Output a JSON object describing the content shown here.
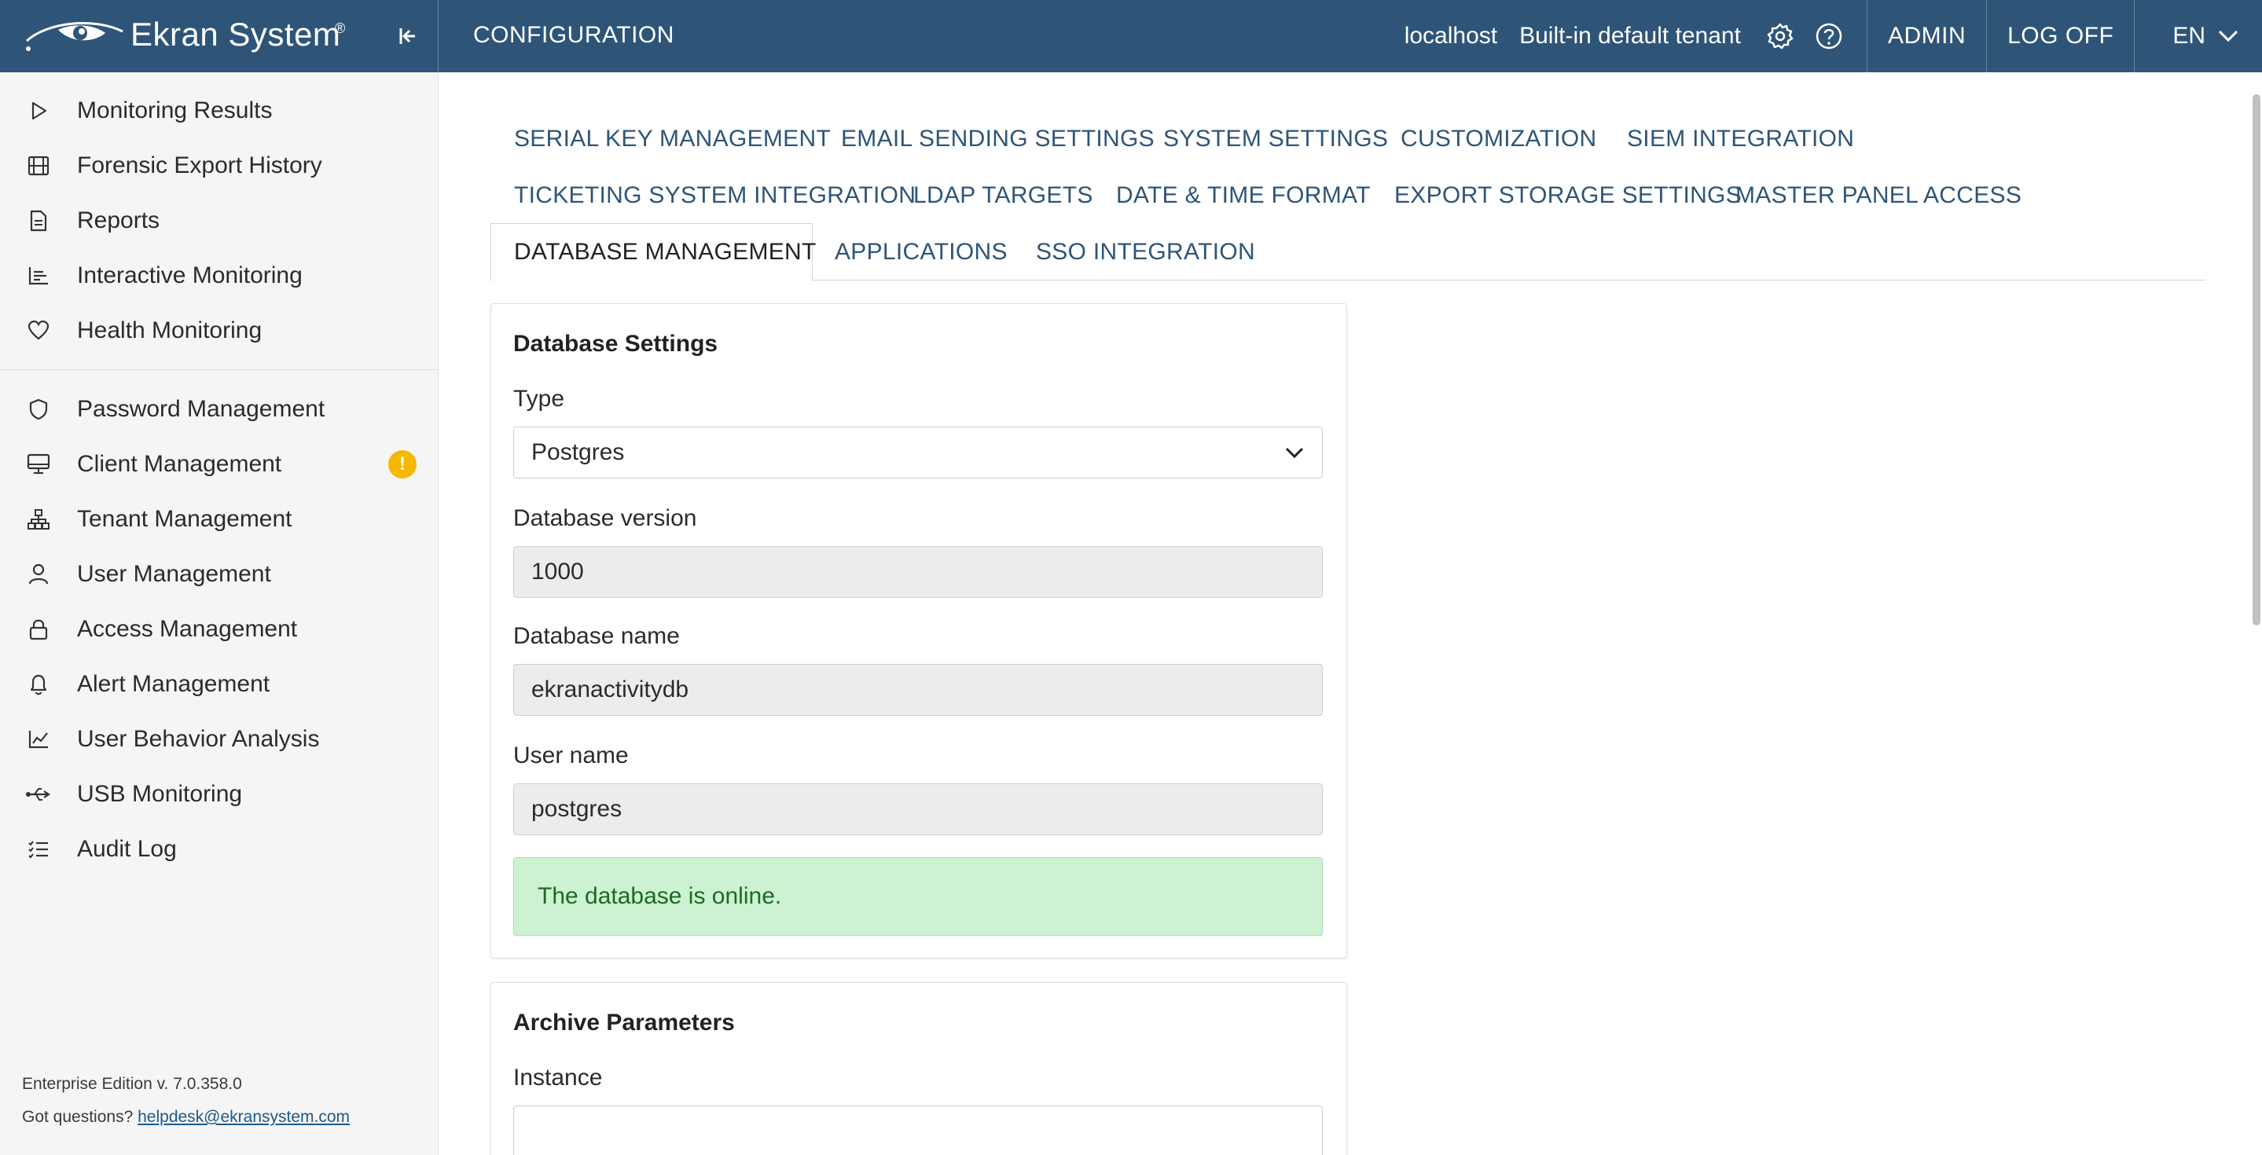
{
  "header": {
    "brand": "Ekran System",
    "brand_mark": "®",
    "page_title": "CONFIGURATION",
    "host": "localhost",
    "tenant": "Built-in default tenant",
    "admin": "ADMIN",
    "logoff": "LOG OFF",
    "language": "EN"
  },
  "sidebar": {
    "group1": [
      {
        "label": "Monitoring Results",
        "icon": "play-icon"
      },
      {
        "label": "Forensic Export History",
        "icon": "film-icon"
      },
      {
        "label": "Reports",
        "icon": "document-icon"
      },
      {
        "label": "Interactive Monitoring",
        "icon": "bar-chart-icon"
      },
      {
        "label": "Health Monitoring",
        "icon": "heart-icon"
      }
    ],
    "group2": [
      {
        "label": "Password Management",
        "icon": "shield-icon"
      },
      {
        "label": "Client Management",
        "icon": "monitor-icon"
      },
      {
        "label": "Tenant Management",
        "icon": "hierarchy-icon"
      },
      {
        "label": "User Management",
        "icon": "user-icon"
      },
      {
        "label": "Access Management",
        "icon": "lock-icon"
      },
      {
        "label": "Alert Management",
        "icon": "bell-icon"
      },
      {
        "label": "User Behavior Analysis",
        "icon": "trend-icon"
      },
      {
        "label": "USB Monitoring",
        "icon": "usb-icon"
      },
      {
        "label": "Audit Log",
        "icon": "checklist-icon"
      }
    ],
    "client_badge": "!",
    "edition": "Enterprise Edition v. 7.0.358.0",
    "questions": "Got questions?",
    "email": "helpdesk@ekransystem.com"
  },
  "tabs": {
    "row1": [
      "SERIAL KEY MANAGEMENT",
      "EMAIL SENDING SETTINGS",
      "SYSTEM SETTINGS",
      "CUSTOMIZATION",
      "SIEM INTEGRATION"
    ],
    "row2": [
      "TICKETING SYSTEM INTEGRATION",
      "LDAP TARGETS",
      "DATE & TIME FORMAT",
      "EXPORT STORAGE SETTINGS",
      "MASTER PANEL ACCESS"
    ],
    "row3": [
      "DATABASE MANAGEMENT",
      "APPLICATIONS",
      "SSO INTEGRATION"
    ],
    "active": "DATABASE MANAGEMENT"
  },
  "database_settings": {
    "title": "Database Settings",
    "type_label": "Type",
    "type_value": "Postgres",
    "version_label": "Database version",
    "version_value": "1000",
    "name_label": "Database name",
    "name_value": "ekranactivitydb",
    "user_label": "User name",
    "user_value": "postgres",
    "status": "The database is online."
  },
  "archive": {
    "title": "Archive Parameters",
    "instance_label": "Instance",
    "instance_value": ""
  },
  "colors": {
    "header_bg": "#2e5578",
    "sidebar_bg": "#f5f5f5",
    "tab_text": "#2e5578",
    "success_bg": "#cdf2d1",
    "success_text": "#1a6a24",
    "badge": "#f5b800"
  }
}
